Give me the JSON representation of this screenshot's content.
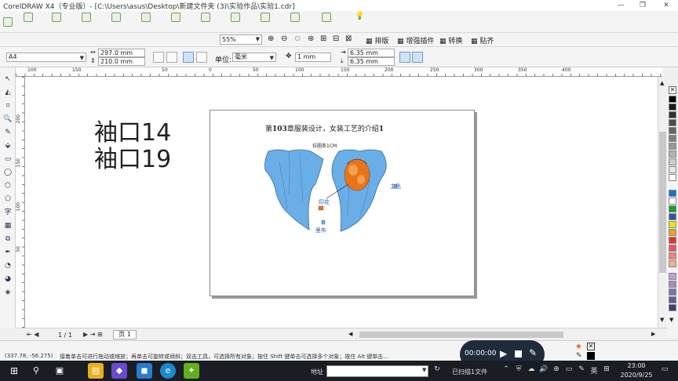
{
  "window": {
    "title": "CorelDRAW X4（专业版）- [C:\\Users\\asus\\Desktop\\新建文件夹 (3)\\实验作品\\实验1.cdr]",
    "minimize": "—",
    "maximize": "❐",
    "close": "✕"
  },
  "toolbar2": {
    "zoom_value": "55%",
    "buttons": [
      "排版",
      "增强插件",
      "转换",
      "贴齐"
    ]
  },
  "propbar": {
    "paper_size": "A4",
    "width": "297.0 mm",
    "height": "210.0 mm",
    "units_label": "单位:",
    "units_value": "毫米",
    "nudge": "1 mm",
    "dup_x": "6.35 mm",
    "dup_y": "6.35 mm"
  },
  "rulers": {
    "h_labels": [
      "100",
      "150",
      "50",
      "0",
      "50",
      "100",
      "150",
      "200",
      "250",
      "300",
      "350",
      "400"
    ],
    "v_labels": [
      "200",
      "150",
      "100",
      "50"
    ]
  },
  "canvas": {
    "text_line1": "袖口14",
    "text_line2": "袖口19",
    "page_title_pre": "第",
    "page_title_num": "103",
    "page_title_mid": "章服装设计，女装工艺的介绍",
    "page_title_suf": "1",
    "caption": "拉圈条1CM",
    "label_print": "印花",
    "label_main": "主色",
    "label_fabric": "里布"
  },
  "pager": {
    "page_count": "1 / 1",
    "page_tab": "页 1"
  },
  "statusbar": {
    "coords": "(337.78, -56.275)",
    "hint": "接着单击可进行拖动或缩放；再单击可旋转或倾斜；双击工具，可选择所有对象；按住 Shift 键单击可选择多个对象；按住 Alt 键单击..."
  },
  "player": {
    "time": "00:00:00"
  },
  "taskbar": {
    "address_label": "地址",
    "tray_text": "已扫描1文件",
    "clock_time": "23:00",
    "clock_date": "2020/9/25"
  },
  "palette_colors": [
    "#ffffff",
    "#000000",
    "#1a1a1a",
    "#333333",
    "#4d4d4d",
    "#666666",
    "#808080",
    "#999999",
    "#b3b3b3",
    "#cccccc",
    "#e6e6e6",
    "#ffffff",
    "#1f6fd1",
    "#ffffff",
    "#1a9a3a",
    "#2a5a9a",
    "#f0e020",
    "#f0a020",
    "#e83030",
    "#f05070",
    "#f08080",
    "#c0a0d0",
    "#a090c0",
    "#8070b0",
    "#606090",
    "#404070"
  ]
}
